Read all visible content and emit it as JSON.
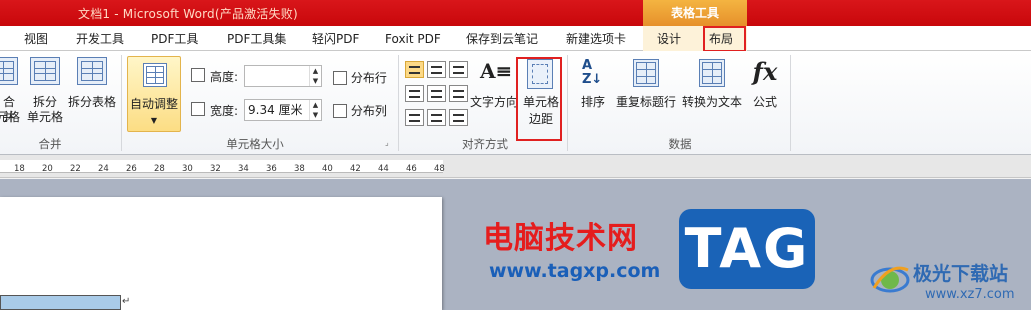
{
  "window": {
    "title": "文档1 - Microsoft Word(产品激活失败)"
  },
  "context_tab_group": {
    "label": "表格工具"
  },
  "tabs": [
    {
      "label": "视图"
    },
    {
      "label": "开发工具"
    },
    {
      "label": "PDF工具"
    },
    {
      "label": "PDF工具集"
    },
    {
      "label": "轻闪PDF"
    },
    {
      "label": "Foxit PDF"
    },
    {
      "label": "保存到云笔记"
    },
    {
      "label": "新建选项卡"
    },
    {
      "label": "设计"
    },
    {
      "label": "布局"
    }
  ],
  "ribbon": {
    "merge": {
      "group_label": "合并",
      "merge_cells": [
        "合并",
        "单元格"
      ],
      "split_cells": [
        "拆分",
        "单元格"
      ],
      "split_table": "拆分表格"
    },
    "cell_size": {
      "group_label": "单元格大小",
      "auto_fit": "自动调整",
      "height_label": "高度:",
      "height_value": "",
      "width_label": "宽度:",
      "width_value": "9.34 厘米",
      "distribute_rows": "分布行",
      "distribute_cols": "分布列"
    },
    "alignment": {
      "group_label": "对齐方式",
      "text_direction": "文字方向",
      "cell_margins": [
        "单元格",
        "边距"
      ]
    },
    "data": {
      "group_label": "数据",
      "sort": "排序",
      "repeat_header": "重复标题行",
      "convert_to_text": "转换为文本",
      "formula": "公式",
      "formula_symbol": "fx"
    }
  },
  "ruler": {
    "ticks": [
      "18",
      "20",
      "22",
      "24",
      "26",
      "28",
      "30",
      "32",
      "34",
      "36",
      "38",
      "40",
      "42",
      "44",
      "46",
      "48"
    ]
  },
  "watermark": {
    "title": "电脑技术网",
    "url": "www.tagxp.com",
    "tag": "TAG",
    "site2_title": "极光下载站",
    "site2_url": "www.xz7.com"
  },
  "colors": {
    "title_bar": "#c8070b",
    "context_tab": "#f0a83a",
    "highlight": "#e02020",
    "tag_blue": "#1a63b7"
  },
  "icons": [
    "merge-cells-icon",
    "split-cells-icon",
    "split-table-icon",
    "auto-fit-icon",
    "height-icon",
    "width-icon",
    "distribute-rows-icon",
    "distribute-cols-icon",
    "align-icon",
    "text-direction-icon",
    "cell-margins-icon",
    "sort-icon",
    "repeat-header-icon",
    "convert-text-icon",
    "formula-icon"
  ]
}
